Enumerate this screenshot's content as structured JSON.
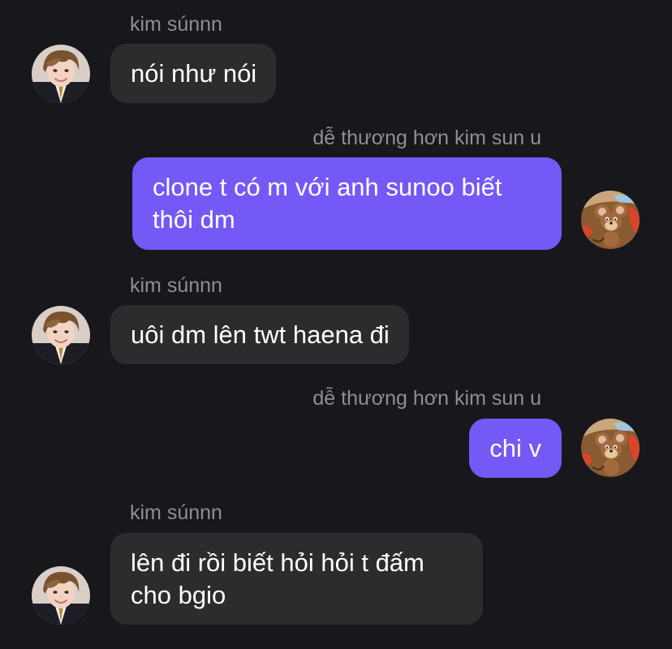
{
  "conversation": {
    "messages": [
      {
        "direction": "incoming",
        "sender": "kim súnnn",
        "text": "nói như nói",
        "avatar_icon": "boy-portrait-avatar-icon"
      },
      {
        "direction": "outgoing",
        "sender": "dễ thương hơn kim sun u",
        "text": "clone t có m với anh sunoo biết thôi dm",
        "avatar_icon": "cartoon-mouse-avatar-icon"
      },
      {
        "direction": "incoming",
        "sender": "kim súnnn",
        "text": "uôi dm lên twt haena đi",
        "avatar_icon": "boy-portrait-avatar-icon"
      },
      {
        "direction": "outgoing",
        "sender": "dễ thương hơn kim sun u",
        "text": "chi v",
        "avatar_icon": "cartoon-mouse-avatar-icon"
      },
      {
        "direction": "incoming",
        "sender": "kim súnnn",
        "text": "lên đi rồi biết hỏi hỏi t đấm cho bgio",
        "avatar_icon": "boy-portrait-avatar-icon"
      }
    ]
  },
  "colors": {
    "background": "#18171c",
    "incoming_bubble": "#2c2c2f",
    "outgoing_bubble": "#7459f7",
    "sender_name": "#8e8e93",
    "message_text": "#ffffff"
  }
}
